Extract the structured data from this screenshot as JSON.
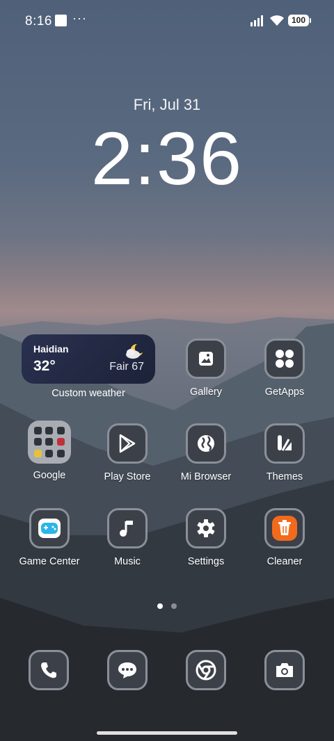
{
  "status_bar": {
    "time": "8:16",
    "more": "···",
    "battery": "100"
  },
  "lockclock": {
    "date": "Fri, Jul 31",
    "time": "2:36"
  },
  "weather_widget": {
    "city": "Haidian",
    "temp": "32°",
    "condition": "Fair 67",
    "label": "Custom weather"
  },
  "apps": {
    "gallery": "Gallery",
    "getapps": "GetApps",
    "google": "Google",
    "playstore": "Play Store",
    "mibrowser": "Mi Browser",
    "themes": "Themes",
    "gamecenter": "Game Center",
    "music": "Music",
    "settings": "Settings",
    "cleaner": "Cleaner"
  },
  "dock": [
    "phone-icon",
    "messages-icon",
    "chrome-icon",
    "camera-icon"
  ],
  "colors": {
    "cleaner_accent": "#f26a1b",
    "game_accent": "#2bb5e8"
  },
  "pager": {
    "pages": 2,
    "active": 1
  }
}
